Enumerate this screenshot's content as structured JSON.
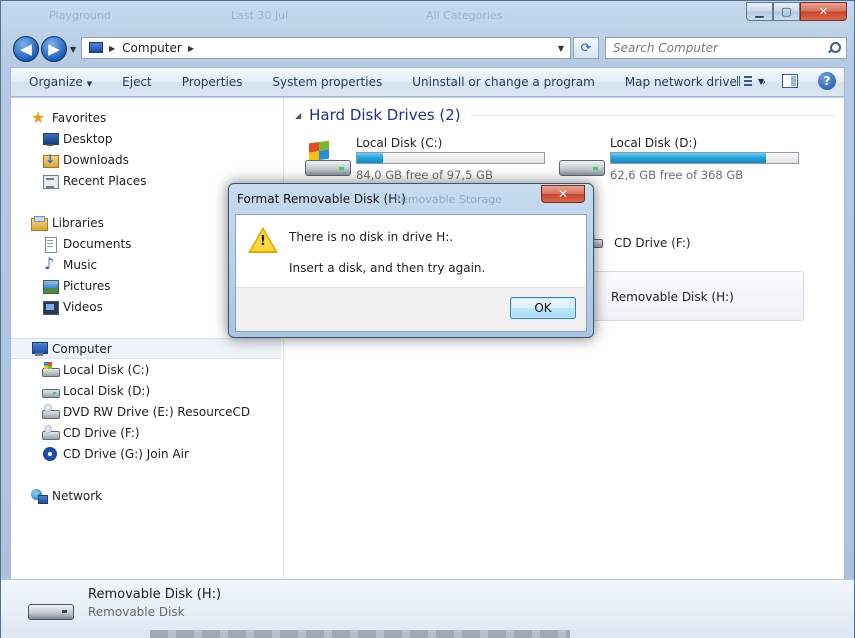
{
  "window": {
    "ghost_titles": [
      "Playground",
      "Last 30 Jul",
      "All Categories"
    ],
    "minimize": "▁",
    "maximize": "▢",
    "close": "✕"
  },
  "nav": {
    "back": "◀",
    "forward": "▶",
    "address_segments": [
      "Computer"
    ],
    "refresh": "⟳",
    "search_placeholder": "Search Computer"
  },
  "toolbar": {
    "items": [
      "Organize",
      "Eject",
      "Properties",
      "System properties",
      "Uninstall or change a program",
      "Map network drive"
    ],
    "more": "»",
    "help": "?"
  },
  "sidebar": {
    "favorites": {
      "label": "Favorites",
      "items": [
        "Desktop",
        "Downloads",
        "Recent Places"
      ]
    },
    "libraries": {
      "label": "Libraries",
      "items": [
        "Documents",
        "Music",
        "Pictures",
        "Videos"
      ]
    },
    "computer": {
      "label": "Computer",
      "items": [
        "Local Disk (C:)",
        "Local Disk (D:)",
        "DVD RW Drive (E:) ResourceCD",
        "CD Drive (F:)",
        "CD Drive (G:) Join Air"
      ]
    },
    "network": {
      "label": "Network"
    }
  },
  "main": {
    "hard_disk_header": "Hard Disk Drives (2)",
    "drives": [
      {
        "name": "Local Disk (C:)",
        "free": "84,0 GB free of 97,5 GB",
        "used_fraction": 0.14
      },
      {
        "name": "Local Disk (D:)",
        "free": "62,6 GB free of 368 GB",
        "used_fraction": 0.83
      }
    ],
    "cd_drive": "CD Drive (F:)",
    "removable": "Removable Disk (H:)"
  },
  "details": {
    "name": "Removable Disk (H:)",
    "type": "Removable Disk"
  },
  "dialog": {
    "title": "Format Removable Disk (H:)",
    "ghost": "Removable Storage",
    "close": "✕",
    "message1": "There is no disk in drive H:.",
    "message2": "Insert a disk, and then try again.",
    "ok": "OK"
  }
}
